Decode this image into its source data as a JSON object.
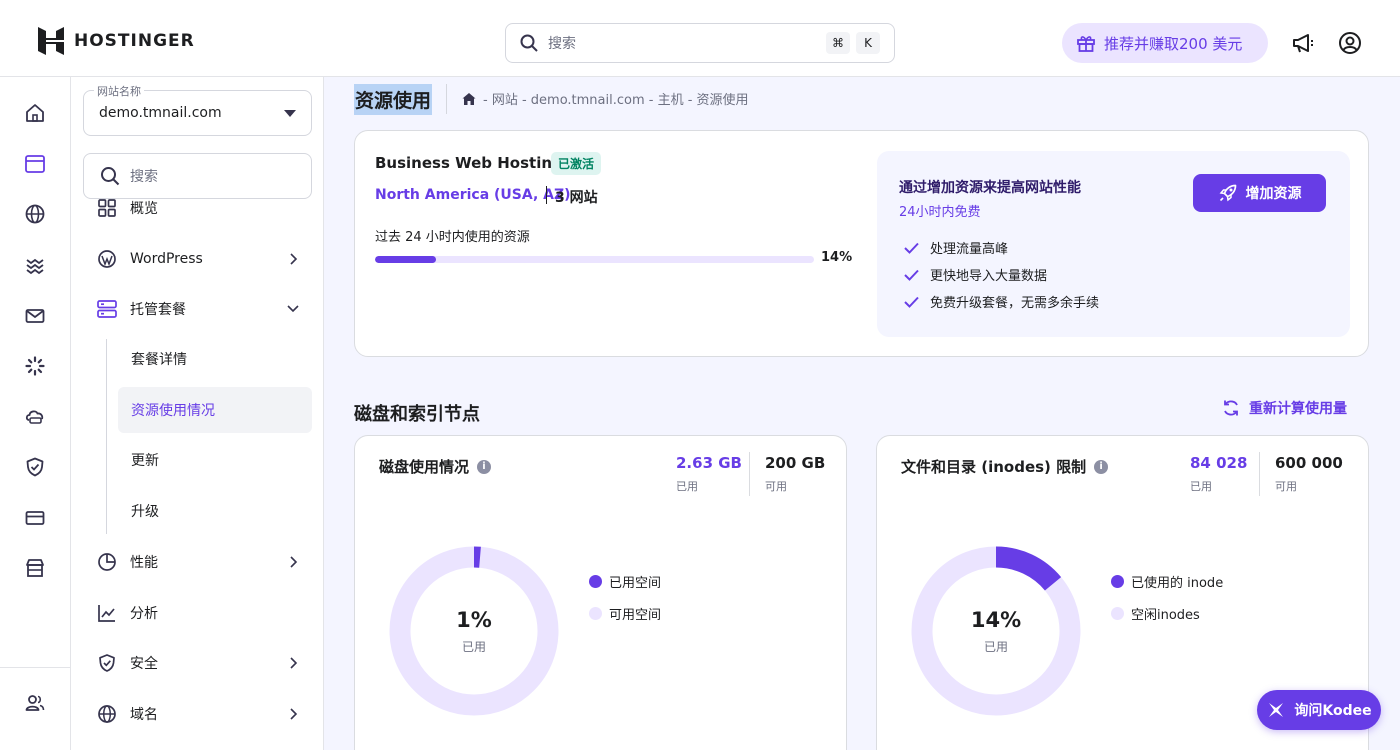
{
  "header": {
    "brand": "HOSTINGER",
    "search_placeholder": "搜索",
    "kbd_cmd": "⌘",
    "kbd_k": "K",
    "refer_label": "推荐并赚取200 美元"
  },
  "sidebar": {
    "site_legend": "网站名称",
    "site_value": "demo.tmnail.com",
    "search_placeholder": "搜索",
    "items": [
      {
        "label": "概览"
      },
      {
        "label": "WordPress"
      },
      {
        "label": "托管套餐"
      },
      {
        "label": "性能"
      },
      {
        "label": "分析"
      },
      {
        "label": "安全"
      },
      {
        "label": "域名"
      }
    ],
    "sub_items": [
      {
        "label": "套餐详情"
      },
      {
        "label": "资源使用情况"
      },
      {
        "label": "更新"
      },
      {
        "label": "升级"
      }
    ]
  },
  "page": {
    "title": "资源使用",
    "breadcrumb": "- 网站 - demo.tmnail.com - 主机 - 资源使用"
  },
  "plan": {
    "name": "Business Web Hosting",
    "status": "已激活",
    "region": "North America (USA, AZ)",
    "sites": "3 网站",
    "usage_label": "过去 24 小时内使用的资源",
    "usage_pct_text": "14%",
    "usage_fraction": 0.14,
    "promo_title": "通过增加资源来提高网站性能",
    "promo_sub": "24小时内免费",
    "promo_button": "增加资源",
    "benefits": [
      "处理流量高峰",
      "更快地导入大量数据",
      "免费升级套餐，无需多余手续"
    ]
  },
  "section": {
    "title": "磁盘和索引节点",
    "recalc_label": "重新计算使用量"
  },
  "disk": {
    "title": "磁盘使用情况",
    "used_value": "2.63 GB",
    "used_label": "已用",
    "avail_value": "200 GB",
    "avail_label": "可用",
    "pct_text": "1%",
    "pct_fraction": 0.013,
    "center_label": "已用",
    "legend_used": "已用空间",
    "legend_free": "可用空间"
  },
  "inodes": {
    "title": "文件和目录 (inodes) 限制",
    "used_value": "84 028",
    "used_label": "已用",
    "avail_value": "600 000",
    "avail_label": "可用",
    "pct_text": "14%",
    "pct_fraction": 0.14,
    "center_label": "已用",
    "legend_used": "已使用的 inode",
    "legend_free": "空闲inodes"
  },
  "assistant": {
    "label": "询问Kodee"
  },
  "colors": {
    "accent": "#673de6",
    "accent_light": "#ebe4ff",
    "success_bg": "#def4f0",
    "success_text": "#008361"
  }
}
